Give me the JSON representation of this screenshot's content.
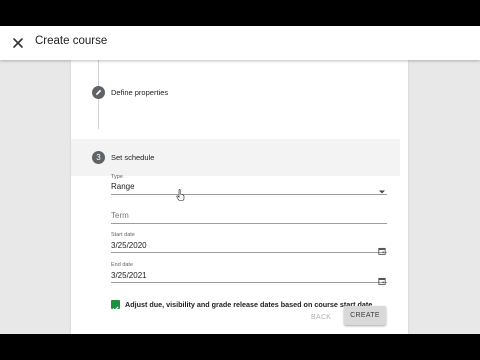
{
  "app_bar": {
    "title": "Create course",
    "close_icon": "close-icon"
  },
  "stepper": {
    "steps": [
      {
        "marker": "",
        "marker_icon": "pencil-icon",
        "label": "Define properties",
        "state": "completed"
      },
      {
        "marker": "3",
        "label": "Set schedule",
        "state": "active"
      }
    ]
  },
  "form": {
    "type": {
      "label": "Type",
      "value": "Range"
    },
    "term": {
      "placeholder": "Term",
      "value": ""
    },
    "start_date": {
      "label": "Start date",
      "value": "3/25/2020"
    },
    "end_date": {
      "label": "End date",
      "value": "3/25/2021"
    },
    "adjust_dates": {
      "checked": true,
      "label": "Adjust due, visibility and grade release dates based on course start date"
    }
  },
  "actions": {
    "back_label": "BACK",
    "create_label": "CREATE"
  },
  "colors": {
    "checkbox": "#1e8e3e",
    "step_circle": "#5f6368",
    "active_step_bg": "#f3f3f3"
  }
}
